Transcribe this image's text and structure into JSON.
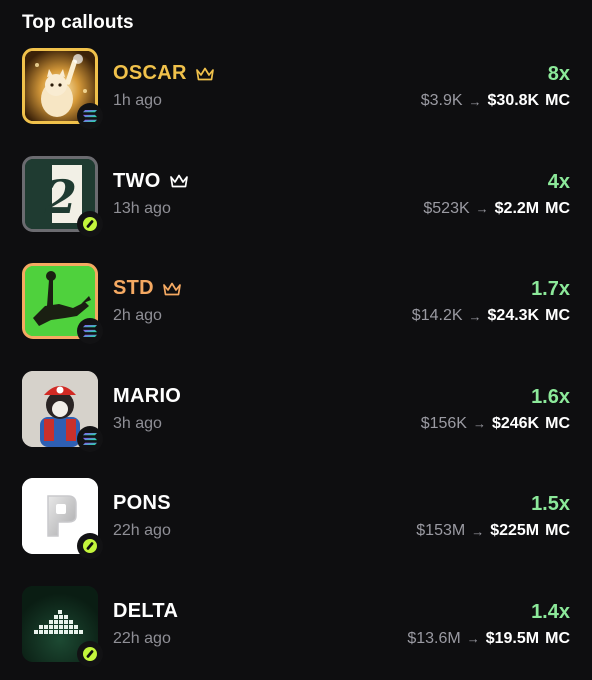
{
  "header": {
    "title": "Top callouts"
  },
  "colors": {
    "gold": "#f0c14b",
    "orange": "#f5a962",
    "white": "#ffffff",
    "green": "#8ce99a",
    "muted": "#8f8f96"
  },
  "callouts": [
    {
      "name": "OSCAR",
      "time": "1h ago",
      "multiplier": "8x",
      "from": "$3.9K",
      "to": "$30.8K",
      "unit": "MC",
      "chain": "solana-icon",
      "crown": true,
      "name_color": "#f0c14b"
    },
    {
      "name": "TWO",
      "time": "13h ago",
      "multiplier": "4x",
      "from": "$523K",
      "to": "$2.2M",
      "unit": "MC",
      "chain": "pump-icon",
      "crown": true,
      "name_color": "#ffffff"
    },
    {
      "name": "STD",
      "time": "2h ago",
      "multiplier": "1.7x",
      "from": "$14.2K",
      "to": "$24.3K",
      "unit": "MC",
      "chain": "solana-icon",
      "crown": true,
      "name_color": "#f5a962"
    },
    {
      "name": "MARIO",
      "time": "3h ago",
      "multiplier": "1.6x",
      "from": "$156K",
      "to": "$246K",
      "unit": "MC",
      "chain": "solana-icon",
      "crown": false,
      "name_color": "#ffffff"
    },
    {
      "name": "PONS",
      "time": "22h ago",
      "multiplier": "1.5x",
      "from": "$153M",
      "to": "$225M",
      "unit": "MC",
      "chain": "pump-icon",
      "crown": false,
      "name_color": "#ffffff"
    },
    {
      "name": "DELTA",
      "time": "22h ago",
      "multiplier": "1.4x",
      "from": "$13.6M",
      "to": "$19.5M",
      "unit": "MC",
      "chain": "pump-icon",
      "crown": false,
      "name_color": "#ffffff"
    }
  ]
}
